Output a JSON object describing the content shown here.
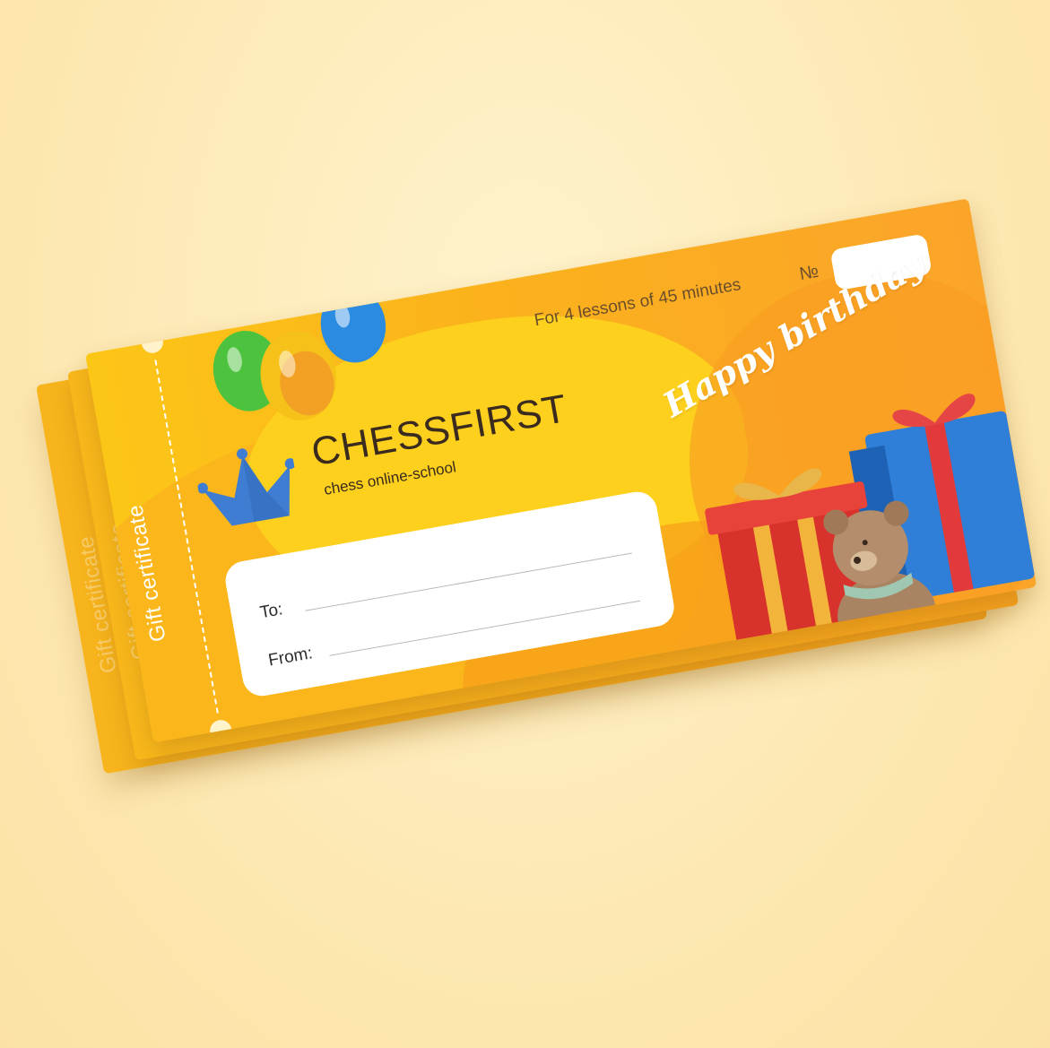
{
  "brand": {
    "name": "CHESSFIRST",
    "tagline": "chess online-school"
  },
  "certificate": {
    "stub_label": "Gift certificate",
    "lessons_text": "For 4 lessons of 45 minutes",
    "number_label": "№",
    "greeting": "Happy birthday"
  },
  "form": {
    "to_label": "To:",
    "from_label": "From:",
    "to_value": "",
    "from_value": ""
  },
  "colors": {
    "ticket_yellow": "#fcc617",
    "ticket_orange": "#fba42a",
    "crown_blue": "#3e7dd1",
    "background": "#fde9b5"
  },
  "icons": [
    "crown-icon",
    "balloons-illustration",
    "gift-boxes-illustration",
    "teddy-bear-illustration"
  ]
}
